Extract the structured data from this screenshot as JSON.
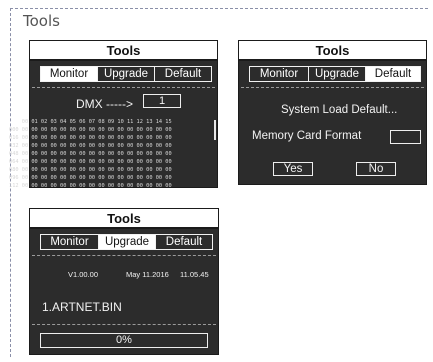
{
  "heading": "Tools",
  "panel_monitor": {
    "title": "Tools",
    "tabs": [
      "Monitor",
      "Upgrade",
      "Default"
    ],
    "active_tab": "Monitor",
    "dmx_label": "DMX ----->",
    "dmx_value": "1",
    "grid_header": "00 01 02 03 04 05 06 07 08 09 10 11 12 13 14 15",
    "row_labels": [
      "000",
      "016",
      "032",
      "048",
      "064",
      "080",
      "096",
      "112"
    ],
    "cell_value": "00"
  },
  "panel_default": {
    "title": "Tools",
    "tabs": [
      "Monitor",
      "Upgrade",
      "Default"
    ],
    "active_tab": "Default",
    "message": "System Load Default...",
    "memory_label": "Memory Card Format",
    "memory_value": "",
    "yes_label": "Yes",
    "no_label": "No"
  },
  "panel_upgrade": {
    "title": "Tools",
    "tabs": [
      "Monitor",
      "Upgrade",
      "Default"
    ],
    "active_tab": "Upgrade",
    "version": "V1.00.00",
    "date": "May 11.2016",
    "time": "11.05.45",
    "filename": "1.ARTNET.BIN",
    "progress_label": "0%",
    "progress": 0
  }
}
